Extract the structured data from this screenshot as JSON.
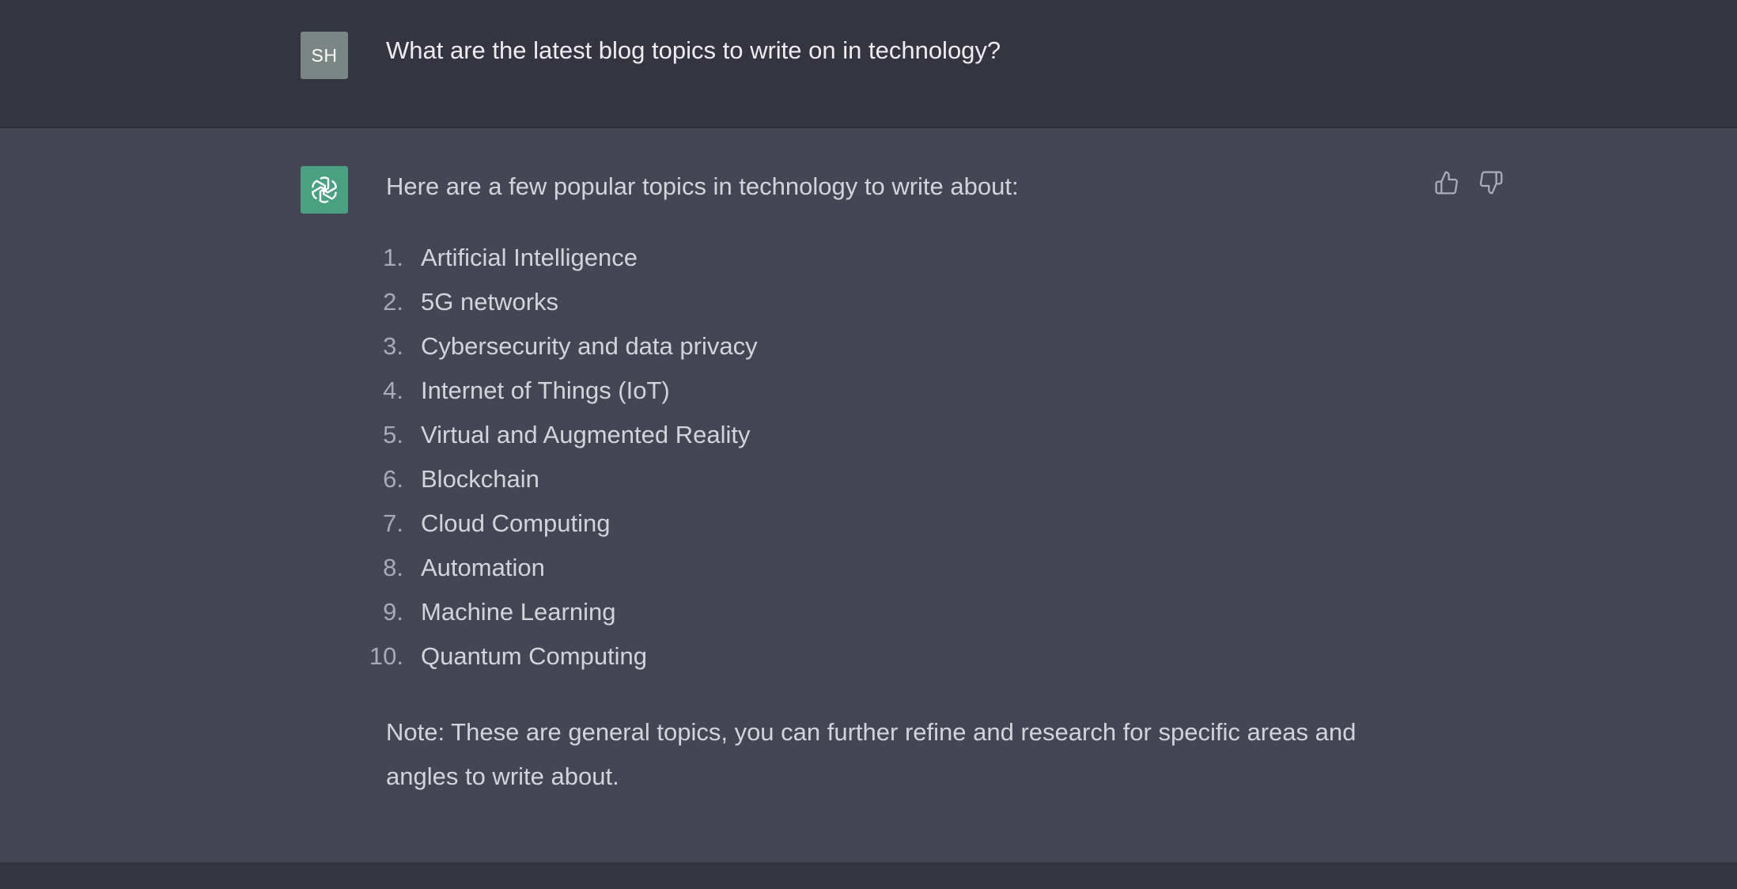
{
  "user_message": {
    "avatar_initials": "SH",
    "text": "What are the latest blog topics to write on in technology?"
  },
  "assistant_message": {
    "avatar_icon": "openai-logo-icon",
    "intro": "Here are a few popular topics in technology to write about:",
    "topics": [
      {
        "num": "1.",
        "label": "Artificial Intelligence"
      },
      {
        "num": "2.",
        "label": "5G networks"
      },
      {
        "num": "3.",
        "label": "Cybersecurity and data privacy"
      },
      {
        "num": "4.",
        "label": "Internet of Things (IoT)"
      },
      {
        "num": "5.",
        "label": "Virtual and Augmented Reality"
      },
      {
        "num": "6.",
        "label": "Blockchain"
      },
      {
        "num": "7.",
        "label": "Cloud Computing"
      },
      {
        "num": "8.",
        "label": "Automation"
      },
      {
        "num": "9.",
        "label": "Machine Learning"
      },
      {
        "num": "10.",
        "label": "Quantum Computing"
      }
    ],
    "note": "Note: These are general topics, you can further refine and research for specific areas and angles to write about."
  },
  "feedback": {
    "thumbs_up_icon": "thumbs-up-icon",
    "thumbs_down_icon": "thumbs-down-icon"
  },
  "colors": {
    "user_bg": "#343541",
    "assistant_bg": "#444654",
    "bot_avatar": "#4aa181",
    "user_avatar": "#7a8584",
    "text": "#d1d5db",
    "muted": "#a8aab6"
  }
}
